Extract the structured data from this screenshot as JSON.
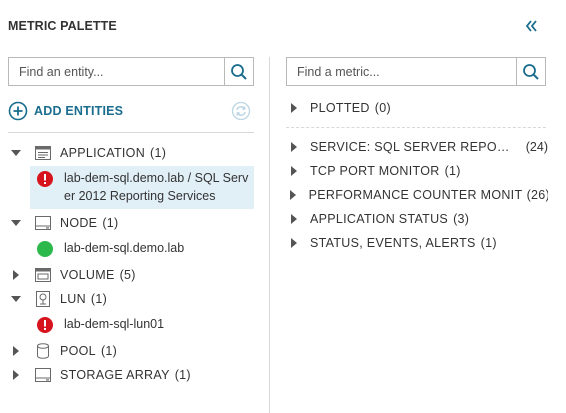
{
  "header": {
    "title": "METRIC PALETTE"
  },
  "entity_search": {
    "placeholder": "Find an entity..."
  },
  "metric_search": {
    "placeholder": "Find a metric..."
  },
  "add_entities": {
    "label": "ADD ENTITIES"
  },
  "colors": {
    "accent": "#1a6d8e",
    "selected_bg": "#e1eff7",
    "status_ok": "#2db84b",
    "status_error": "#d7141d"
  },
  "entity_tree": [
    {
      "label": "APPLICATION",
      "count": "(1)",
      "expanded": true,
      "icon": "application-icon",
      "children": [
        {
          "label_line1": "lab-dem-sql.demo.lab / SQL Serv",
          "label_line2": "er 2012 Reporting Services",
          "status": "error-icon",
          "selected": true
        }
      ]
    },
    {
      "label": "NODE",
      "count": "(1)",
      "expanded": true,
      "icon": "node-icon",
      "children": [
        {
          "label": "lab-dem-sql.demo.lab",
          "status": "ok-icon"
        }
      ]
    },
    {
      "label": "VOLUME",
      "count": "(5)",
      "expanded": false,
      "icon": "volume-icon"
    },
    {
      "label": "LUN",
      "count": "(1)",
      "expanded": true,
      "icon": "lun-icon",
      "children": [
        {
          "label": "lab-dem-sql-lun01",
          "status": "error-icon"
        }
      ]
    },
    {
      "label": "POOL",
      "count": "(1)",
      "expanded": false,
      "icon": "pool-icon"
    },
    {
      "label": "STORAGE ARRAY",
      "count": "(1)",
      "expanded": false,
      "icon": "storage-array-icon"
    }
  ],
  "metric_groups": [
    {
      "label": "PLOTTED",
      "count": "(0)"
    },
    {
      "label": "SERVICE: SQL SERVER REPORTING...",
      "count": "(24)"
    },
    {
      "label": "TCP PORT MONITOR",
      "count": "(1)"
    },
    {
      "label": "PERFORMANCE COUNTER MONITOR",
      "count": "(26)"
    },
    {
      "label": "APPLICATION STATUS",
      "count": "(3)"
    },
    {
      "label": "STATUS, EVENTS, ALERTS",
      "count": "(1)"
    }
  ]
}
